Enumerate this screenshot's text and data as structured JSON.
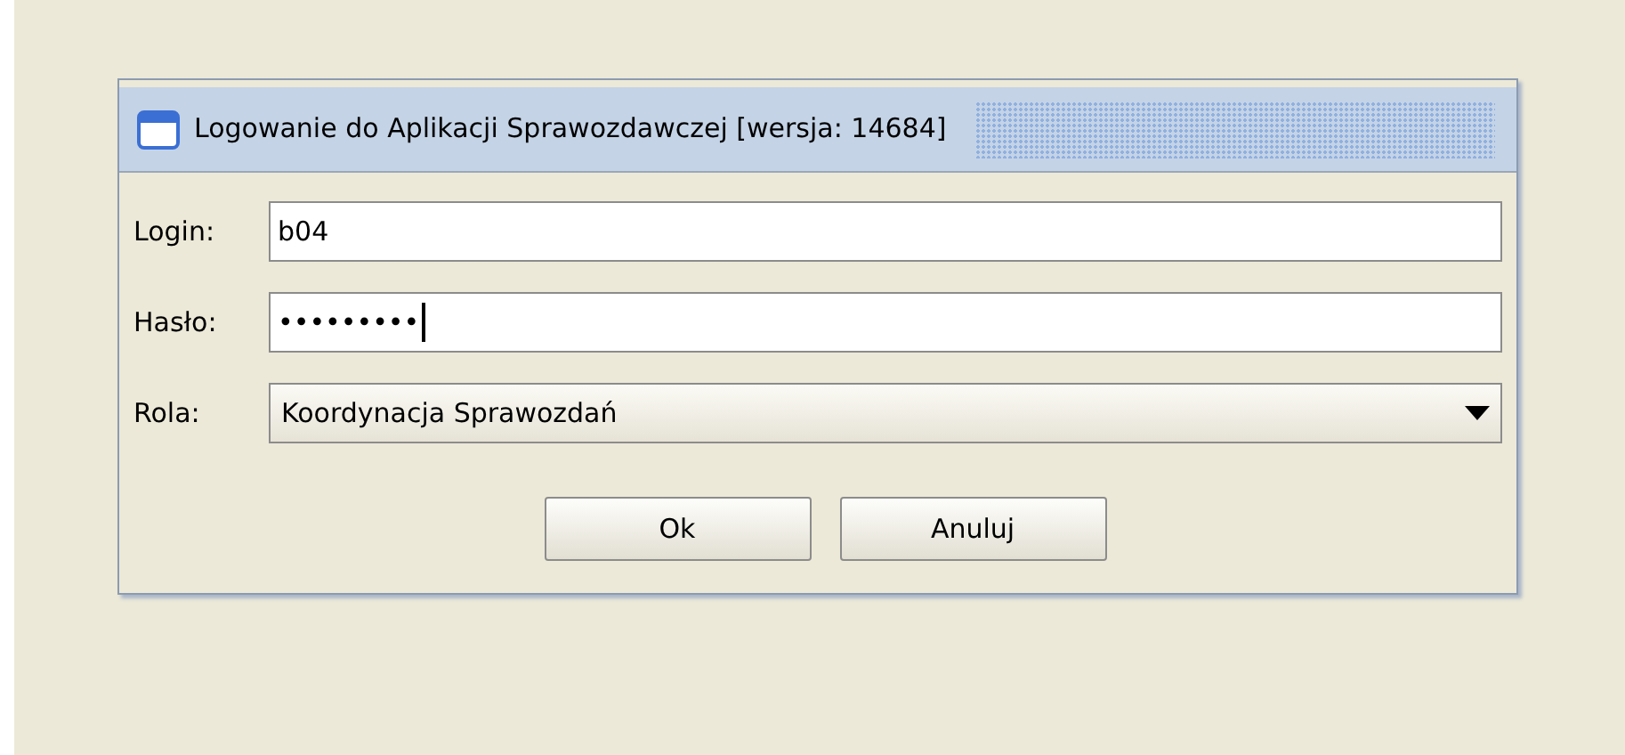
{
  "window": {
    "title": "Logowanie do Aplikacji Sprawozdawczej [wersja: 14684]"
  },
  "fields": [
    {
      "kind": "text",
      "label": "Login:",
      "value": "b04",
      "focused": false
    },
    {
      "kind": "password",
      "label": "Hasło:",
      "value": "•••••••••",
      "focused": true
    },
    {
      "kind": "dropdown",
      "label": "Rola:",
      "value": "Koordynacja Sprawozdań"
    }
  ],
  "buttons": [
    "Ok",
    "Anuluj"
  ]
}
